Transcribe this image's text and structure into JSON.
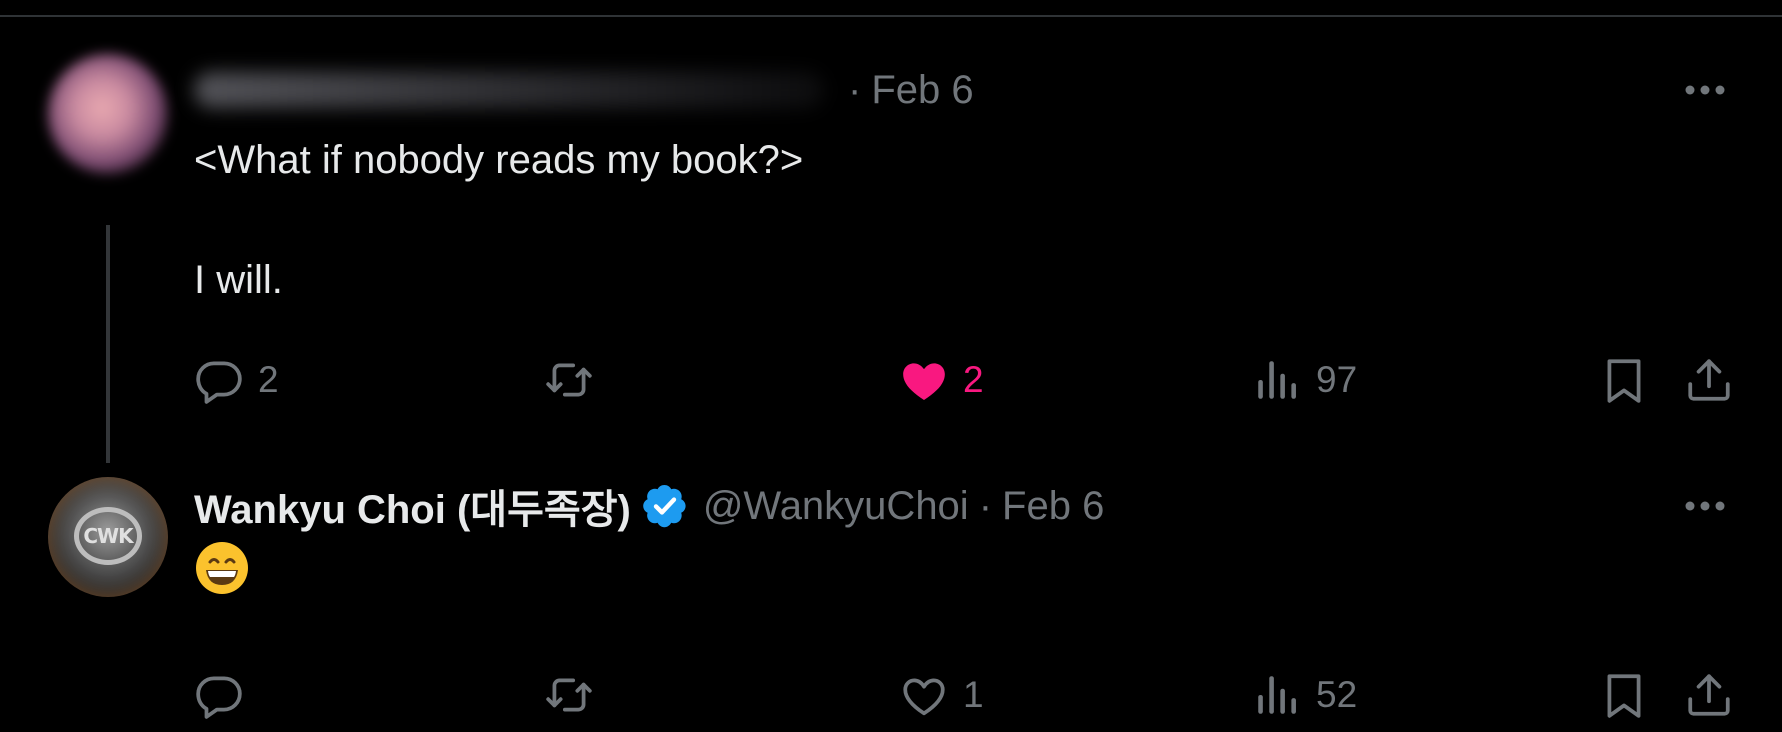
{
  "tweets": [
    {
      "author_name": "",
      "date": "Feb 6",
      "separator": "·",
      "text_lines": [
        "<What if nobody reads my book?>",
        "",
        "I will."
      ],
      "actions": {
        "replies": "2",
        "reposts": "",
        "likes": "2",
        "views": "97"
      },
      "liked": true
    },
    {
      "author_name": "Wankyu Choi (대두족장)",
      "verified": true,
      "handle": "@WankyuChoi",
      "separator": "·",
      "date": "Feb 6",
      "avatar_text": "CWK",
      "emoji": "😄",
      "actions": {
        "replies": "",
        "reposts": "",
        "likes": "1",
        "views": "52"
      },
      "liked": false
    }
  ],
  "colors": {
    "background": "#000000",
    "text": "#e7e9ea",
    "secondary": "#71767b",
    "like": "#f91880",
    "verified": "#1d9bf0",
    "divider": "#2f3336"
  },
  "icons": [
    "reply-icon",
    "repost-icon",
    "heart-icon",
    "views-icon",
    "bookmark-icon",
    "share-icon",
    "more-icon",
    "verified-badge-icon"
  ]
}
